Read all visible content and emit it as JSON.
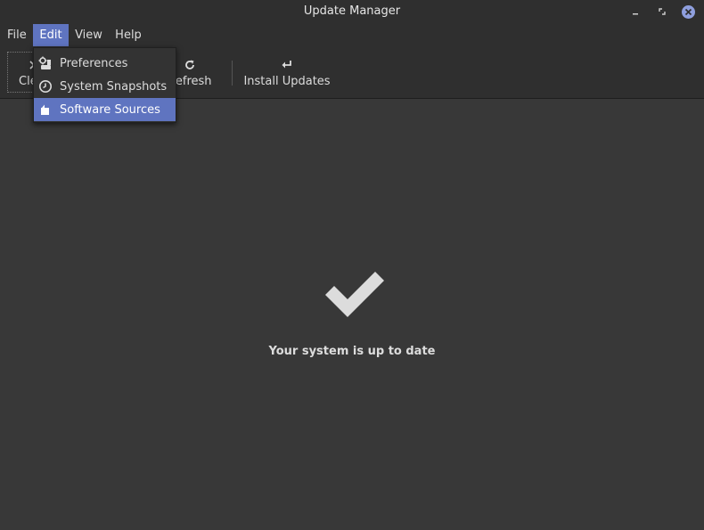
{
  "window": {
    "title": "Update Manager"
  },
  "menubar": {
    "items": [
      {
        "label": "File"
      },
      {
        "label": "Edit"
      },
      {
        "label": "View"
      },
      {
        "label": "Help"
      }
    ]
  },
  "toolbar": {
    "clear_label": "Clear",
    "refresh_label": "Refresh",
    "install_label": "Install Updates"
  },
  "edit_menu": {
    "items": [
      {
        "label": "Preferences",
        "icon": "preferences-icon"
      },
      {
        "label": "System Snapshots",
        "icon": "clock-icon"
      },
      {
        "label": "Software Sources",
        "icon": "package-icon",
        "active": true
      }
    ]
  },
  "status": {
    "message": "Your system is up to date",
    "icon": "checkmark-icon"
  },
  "colors": {
    "accent": "#5f74c0",
    "background": "#383838",
    "bar": "#2f2f2f",
    "close_button": "#8f9fde"
  }
}
